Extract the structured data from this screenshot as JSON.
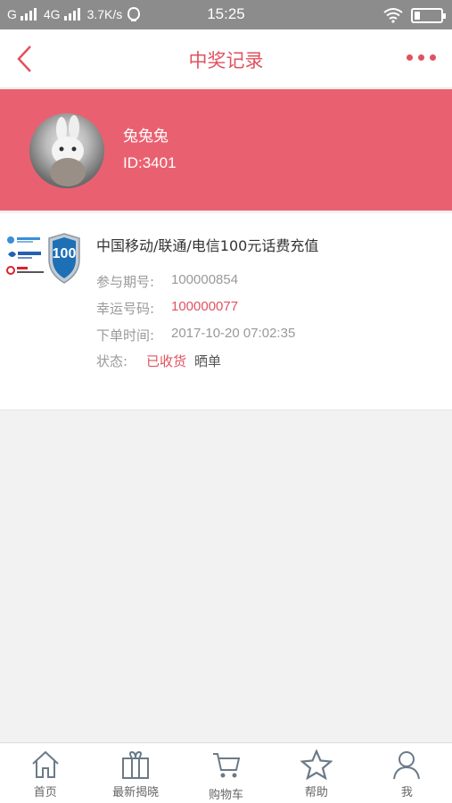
{
  "status_bar": {
    "carrier1": "G",
    "carrier2": "4G",
    "speed": "3.7K/s",
    "time": "15:25"
  },
  "header": {
    "title": "中奖记录"
  },
  "profile": {
    "name": "兔兔兔",
    "id": "ID:3401"
  },
  "record": {
    "product_name": "中国移动/联通/电信100元话费充值",
    "badge_number": "100",
    "issue_label": "参与期号:",
    "issue_value": "100000854",
    "lucky_label": "幸运号码:",
    "lucky_value": "100000077",
    "time_label": "下单时间:",
    "time_value": "2017-10-20 07:02:35",
    "status_label": "状态:",
    "status_value": "已收货",
    "share_label": "晒单"
  },
  "tabs": [
    {
      "label": "首页",
      "icon": "home-icon"
    },
    {
      "label": "最新揭晓",
      "icon": "gift-icon"
    },
    {
      "label": "购物车",
      "icon": "cart-icon"
    },
    {
      "label": "帮助",
      "icon": "star-icon"
    },
    {
      "label": "我",
      "icon": "user-icon"
    }
  ],
  "colors": {
    "accent": "#e0525f",
    "banner": "#e96170"
  }
}
